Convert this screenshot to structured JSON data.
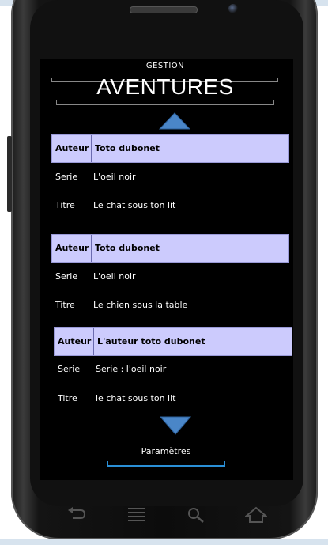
{
  "header": {
    "subtitle": "GESTION",
    "title": "AVENTURES"
  },
  "labels": {
    "auteur": "Auteur",
    "serie": "Serie",
    "titre": "Titre"
  },
  "adventures": [
    {
      "auteur": "Toto dubonet",
      "serie": "L'oeil noir",
      "titre": "Le chat sous ton lit"
    },
    {
      "auteur": "Toto dubonet",
      "serie": "L'oeil noir",
      "titre": "Le chien sous la table"
    },
    {
      "auteur": "L'auteur toto dubonet",
      "serie": "Serie : l'oeil noir",
      "titre": "le chat sous ton lit"
    }
  ],
  "footer": {
    "settings_label": "Paramètres"
  },
  "icons": {
    "scroll_up": "triangle-up-icon",
    "scroll_down": "triangle-down-icon",
    "back": "back-icon",
    "menu": "menu-icon",
    "search": "search-icon",
    "home": "home-icon"
  },
  "colors": {
    "header_row": "#cccbfd",
    "accent": "#3a6fb0",
    "settings_line": "#2a8fd6"
  }
}
